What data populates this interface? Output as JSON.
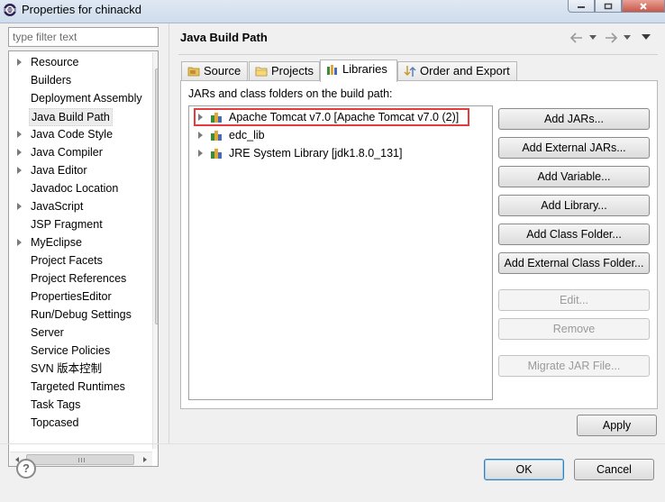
{
  "window": {
    "title": "Properties for chinackd"
  },
  "sidebar": {
    "filter_placeholder": "type filter text",
    "items": [
      {
        "label": "Resource",
        "expandable": true
      },
      {
        "label": "Builders",
        "expandable": false
      },
      {
        "label": "Deployment Assembly",
        "expandable": false
      },
      {
        "label": "Java Build Path",
        "expandable": false,
        "selected": true
      },
      {
        "label": "Java Code Style",
        "expandable": true
      },
      {
        "label": "Java Compiler",
        "expandable": true
      },
      {
        "label": "Java Editor",
        "expandable": true
      },
      {
        "label": "Javadoc Location",
        "expandable": false
      },
      {
        "label": "JavaScript",
        "expandable": true
      },
      {
        "label": "JSP Fragment",
        "expandable": false
      },
      {
        "label": "MyEclipse",
        "expandable": true
      },
      {
        "label": "Project Facets",
        "expandable": false
      },
      {
        "label": "Project References",
        "expandable": false
      },
      {
        "label": "PropertiesEditor",
        "expandable": false
      },
      {
        "label": "Run/Debug Settings",
        "expandable": false
      },
      {
        "label": "Server",
        "expandable": false
      },
      {
        "label": "Service Policies",
        "expandable": false
      },
      {
        "label": "SVN 版本控制",
        "expandable": false
      },
      {
        "label": "Targeted Runtimes",
        "expandable": false
      },
      {
        "label": "Task Tags",
        "expandable": false
      },
      {
        "label": "Topcased",
        "expandable": false
      }
    ]
  },
  "page": {
    "title": "Java Build Path",
    "tabs": [
      {
        "label": "Source",
        "icon": "source-folder-icon"
      },
      {
        "label": "Projects",
        "icon": "projects-folder-icon"
      },
      {
        "label": "Libraries",
        "icon": "libraries-icon",
        "active": true
      },
      {
        "label": "Order and Export",
        "icon": "order-export-icon"
      }
    ],
    "classpath_label": "JARs and class folders on the build path:",
    "libraries": [
      {
        "label": "Apache Tomcat v7.0 [Apache Tomcat v7.0 (2)]",
        "highlighted": true
      },
      {
        "label": "edc_lib"
      },
      {
        "label": "JRE System Library [jdk1.8.0_131]"
      }
    ],
    "buttons": [
      {
        "label": "Add JARs...",
        "enabled": true
      },
      {
        "label": "Add External JARs...",
        "enabled": true
      },
      {
        "label": "Add Variable...",
        "enabled": true
      },
      {
        "label": "Add Library...",
        "enabled": true
      },
      {
        "label": "Add Class Folder...",
        "enabled": true
      },
      {
        "label": "Add External Class Folder...",
        "enabled": true
      },
      {
        "label": "Edit...",
        "enabled": false
      },
      {
        "label": "Remove",
        "enabled": false
      },
      {
        "label": "Migrate JAR File...",
        "enabled": false
      }
    ],
    "apply_label": "Apply"
  },
  "footer": {
    "help": "?",
    "ok_label": "OK",
    "cancel_label": "Cancel"
  },
  "colors": {
    "highlight": "#e23c3c",
    "default_button_border": "#3c7fb1"
  }
}
